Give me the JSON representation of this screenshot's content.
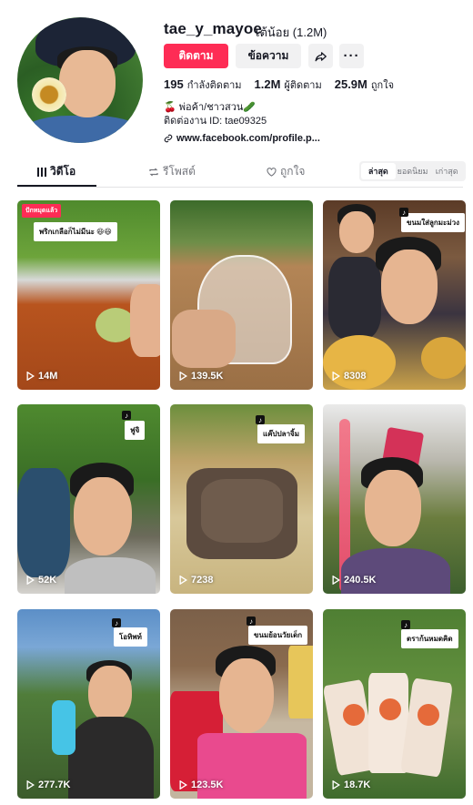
{
  "profile": {
    "username": "tae_y_mayoe",
    "nickname": "เต้น้อย (1.2M)",
    "follow_label": "ติดตาม",
    "message_label": "ข้อความ",
    "more_label": "···",
    "stats": [
      {
        "value": "195",
        "label": "กำลังติดตาม"
      },
      {
        "value": "1.2M",
        "label": "ผู้ติดตาม"
      },
      {
        "value": "25.9M",
        "label": "ถูกใจ"
      }
    ],
    "bio_line1": "🍒 พ่อค้า/ชาวสวน🥒",
    "bio_line2": "ติดต่องาน ID: tae09325",
    "link": "www.facebook.com/profile.p..."
  },
  "tabs": [
    {
      "label": "วิดีโอ"
    },
    {
      "label": "รีโพสต์"
    },
    {
      "label": "ถูกใจ"
    }
  ],
  "sort": [
    "ล่าสุด",
    "ยอดนิยม",
    "เก่าสุด"
  ],
  "videos": [
    {
      "views": "14M",
      "pinned": "ปักหมุดแล้ว",
      "caption": "พริกเกลือก็ไม่มีนะ 😆😆"
    },
    {
      "views": "139.5K"
    },
    {
      "views": "8308",
      "caption": "ขนมใส่ลูกมะม่วง"
    },
    {
      "views": "52K",
      "caption": "ฟูจิ"
    },
    {
      "views": "7238",
      "caption": "แค๊ปปลาจิ้ม"
    },
    {
      "views": "240.5K"
    },
    {
      "views": "277.7K",
      "caption": "โอทิพท์"
    },
    {
      "views": "123.5K",
      "caption": "ขนมย้อนวัยเด็ก"
    },
    {
      "views": "18.7K",
      "caption": "ตราก้นหมดคิด"
    }
  ],
  "colors": {
    "accent": "#fe2c55",
    "button_gray": "#f1f1f2",
    "text": "#161823",
    "muted": "#73757c"
  }
}
